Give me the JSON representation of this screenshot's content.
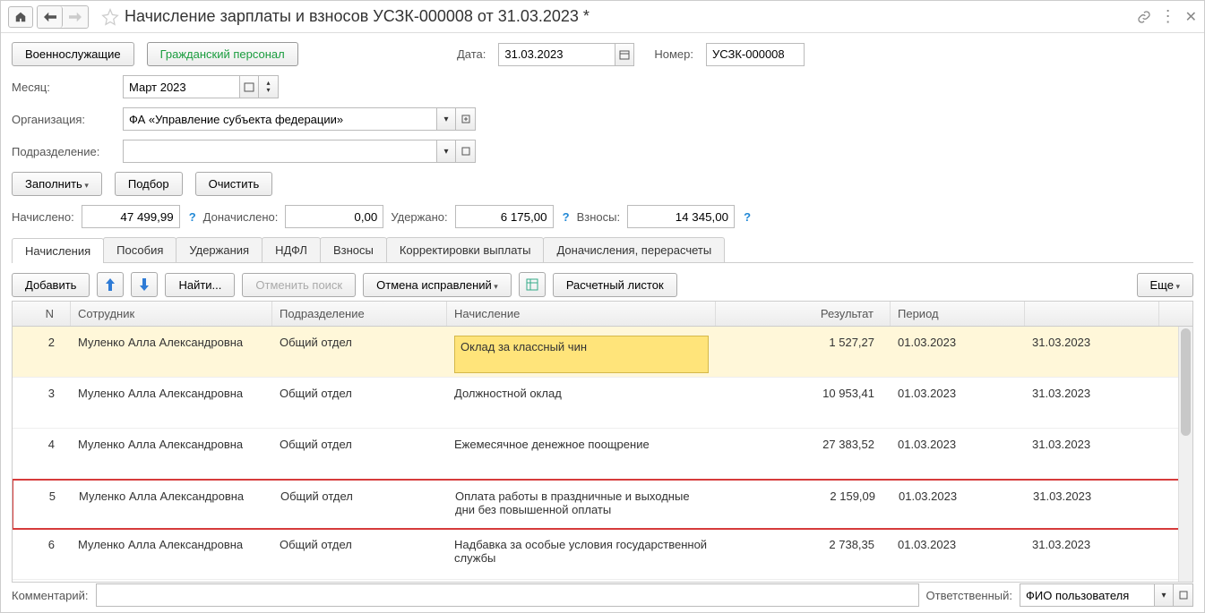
{
  "title": "Начисление зарплаты и взносов УСЗК-000008 от 31.03.2023 *",
  "header": {
    "mode1": "Военнослужащие",
    "mode2": "Гражданский персонал",
    "date_label": "Дата:",
    "date_value": "31.03.2023",
    "number_label": "Номер:",
    "number_value": "УСЗК-000008"
  },
  "fields": {
    "month_label": "Месяц:",
    "month_value": "Март 2023",
    "org_label": "Организация:",
    "org_value": "ФА «Управление субъекта федерации»",
    "dept_label": "Подразделение:",
    "dept_value": ""
  },
  "actions": {
    "fill": "Заполнить",
    "pick": "Подбор",
    "clear": "Очистить"
  },
  "totals": {
    "accrued_label": "Начислено:",
    "accrued": "47 499,99",
    "addl_label": "Доначислено:",
    "addl": "0,00",
    "withheld_label": "Удержано:",
    "withheld": "6 175,00",
    "contrib_label": "Взносы:",
    "contrib": "14 345,00"
  },
  "tabs": [
    "Начисления",
    "Пособия",
    "Удержания",
    "НДФЛ",
    "Взносы",
    "Корректировки выплаты",
    "Доначисления, перерасчеты"
  ],
  "tabToolbar": {
    "add": "Добавить",
    "find": "Найти...",
    "cancel_search": "Отменить поиск",
    "cancel_fix": "Отмена исправлений",
    "payslip": "Расчетный листок",
    "more": "Еще"
  },
  "columns": {
    "n": "N",
    "emp": "Сотрудник",
    "dep": "Подразделение",
    "acc": "Начисление",
    "res": "Результат",
    "per": "Период"
  },
  "rows": [
    {
      "n": "2",
      "emp": "Муленко Алла Александровна",
      "dep": "Общий отдел",
      "acc": "Оклад за классный чин",
      "res": "1 527,27",
      "p1": "01.03.2023",
      "p2": "31.03.2023",
      "hl": true
    },
    {
      "n": "3",
      "emp": "Муленко Алла Александровна",
      "dep": "Общий отдел",
      "acc": "Должностной оклад",
      "res": "10 953,41",
      "p1": "01.03.2023",
      "p2": "31.03.2023"
    },
    {
      "n": "4",
      "emp": "Муленко Алла Александровна",
      "dep": "Общий отдел",
      "acc": "Ежемесячное денежное поощрение",
      "res": "27 383,52",
      "p1": "01.03.2023",
      "p2": "31.03.2023"
    },
    {
      "n": "5",
      "emp": "Муленко Алла Александровна",
      "dep": "Общий отдел",
      "acc": "Оплата работы в праздничные и выходные дни без повышенной оплаты",
      "res": "2 159,09",
      "p1": "01.03.2023",
      "p2": "31.03.2023",
      "red": true
    },
    {
      "n": "6",
      "emp": "Муленко Алла Александровна",
      "dep": "Общий отдел",
      "acc": "Надбавка за особые условия государственной службы",
      "res": "2 738,35",
      "p1": "01.03.2023",
      "p2": "31.03.2023"
    }
  ],
  "footer": {
    "comment_label": "Комментарий:",
    "resp_label": "Ответственный:",
    "resp_value": "ФИО пользователя"
  }
}
